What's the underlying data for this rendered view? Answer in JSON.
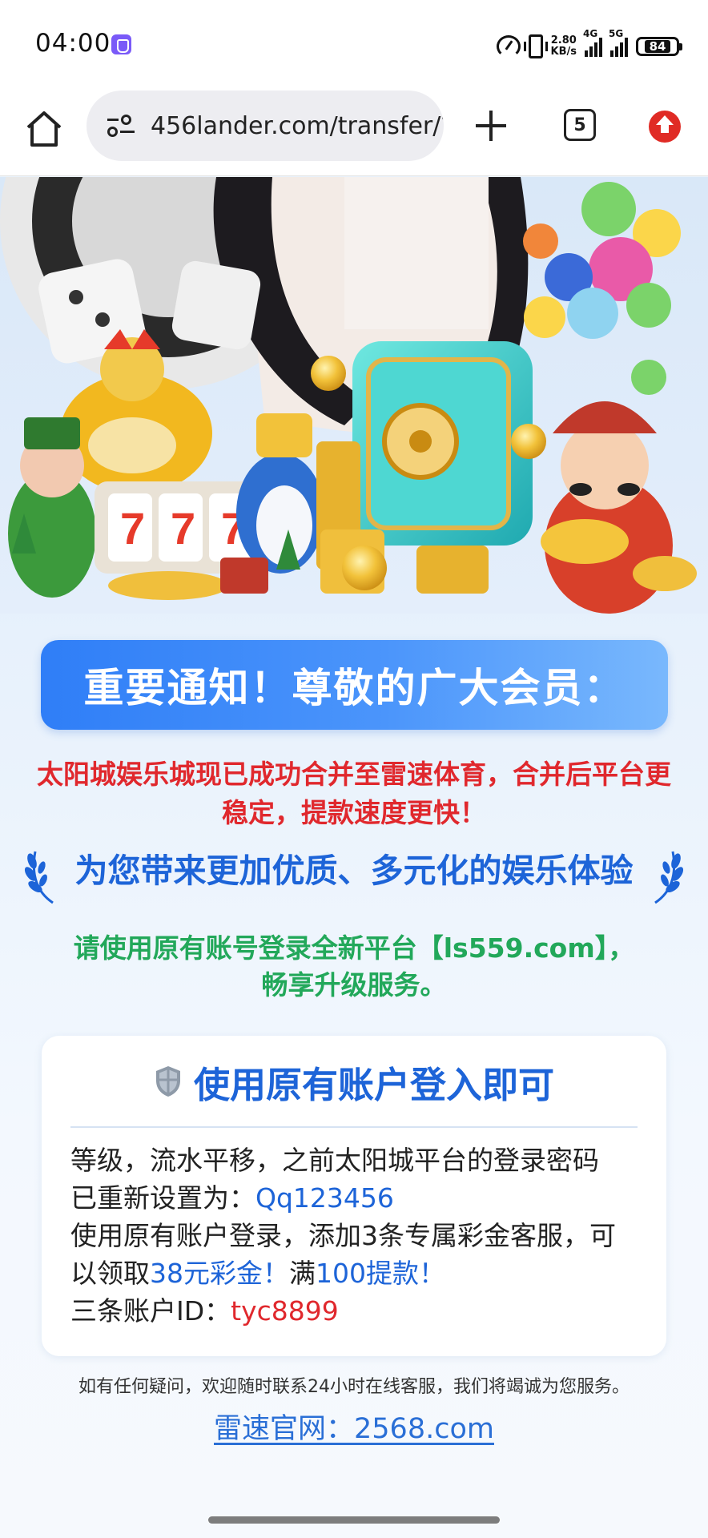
{
  "status_bar": {
    "time": "04:00",
    "net_speed_value": "2.80",
    "net_speed_unit": "KB/s",
    "sim1_label": "4G",
    "sim2_label": "5G",
    "battery": "84"
  },
  "browser": {
    "url": "456lander.com/transfer/?",
    "tab_count": "5"
  },
  "page": {
    "notice_title": "重要通知！尊敬的广大会员：",
    "merge_notice": "太阳城娱乐城现已成功合并至雷速体育，合并后平台更稳定，提款速度更快！",
    "slogan": "为您带来更加优质、多元化的娱乐体验",
    "login_prompt_line1": "请使用原有账号登录全新平台【ls559.com】，",
    "login_prompt_line2": "畅享升级服务。",
    "card": {
      "title": "使用原有账户登入即可",
      "line1": "等级，流水平移，之前太阳城平台的登录密码",
      "line2_prefix": "已重新设置为：",
      "password": "Qq123456",
      "line3": "使用原有账户登录，添加3条专属彩金客服，可",
      "line4_prefix": "以领取",
      "bonus": "38元彩金！",
      "line4_mid": "满",
      "withdraw": "100提款！",
      "line5_prefix": "三条账户ID：",
      "account_id": "tyc8899"
    },
    "support_note": "如有任何疑问，欢迎随时联系24小时在线客服，我们将竭诚为您服务。",
    "official_site": "雷速官网：2568.com"
  },
  "colors": {
    "banner_blue": "#3b86f8",
    "alert_red": "#e0282d",
    "slogan_blue": "#1d64d8",
    "prompt_green": "#22a85a"
  },
  "icons": [
    "home-icon",
    "site-settings-icon",
    "new-tab-icon",
    "tab-switcher-icon",
    "update-icon",
    "shield-icon",
    "laurel-icon"
  ]
}
